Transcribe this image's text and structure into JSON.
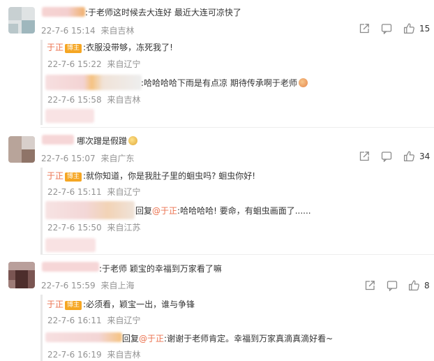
{
  "comments": [
    {
      "text": ":于老师这时候去大连好 最近大连可凉快了",
      "time": "22-7-6 15:14",
      "location": "来自吉林",
      "likes": "15",
      "replies": [
        {
          "name": "于正",
          "badge": "博主",
          "text": ":衣服没带够，冻死我了!",
          "time": "22-7-6 15:22",
          "location": "来自辽宁"
        },
        {
          "text": ":哈哈哈哈下雨是有点凉  期待传承啊于老师",
          "time": "22-7-6 15:58",
          "location": "来自吉林"
        }
      ]
    },
    {
      "text": "哪次蹭是假蹭",
      "time": "22-7-6 15:07",
      "location": "来自广东",
      "likes": "34",
      "replies": [
        {
          "name": "于正",
          "badge": "博主",
          "text": ":就你知道，你是我肚子里的蛔虫吗? 蛔虫你好!",
          "time": "22-7-6 15:11",
          "location": "来自辽宁"
        },
        {
          "reply_prefix": "回复",
          "mention": "@于正",
          "text": ":哈哈哈哈! 要命，有蛔虫画面了......",
          "time": "22-7-6 15:50",
          "location": "来自江苏"
        }
      ]
    },
    {
      "text": ":于老师 颖宝的幸福到万家看了嘛",
      "time": "22-7-6 15:59",
      "location": "来自上海",
      "likes": "8",
      "replies": [
        {
          "name": "于正",
          "badge": "博主",
          "text": ":必须看，颖宝一出，谁与争锋",
          "time": "22-7-6 16:11",
          "location": "来自辽宁"
        },
        {
          "reply_prefix": "回复",
          "mention": "@于正",
          "text": ":谢谢于老师肯定。幸福到万家真滴真滴好看~",
          "time": "22-7-6 16:19",
          "location": "来自吉林"
        }
      ]
    }
  ],
  "icons": {
    "share": "share-icon",
    "comment": "comment-icon",
    "like": "thumbs-up-icon"
  },
  "colors": {
    "author_name": "#eb7350",
    "badge": "#f5a623",
    "meta": "#939393",
    "mention": "#eb7350"
  }
}
